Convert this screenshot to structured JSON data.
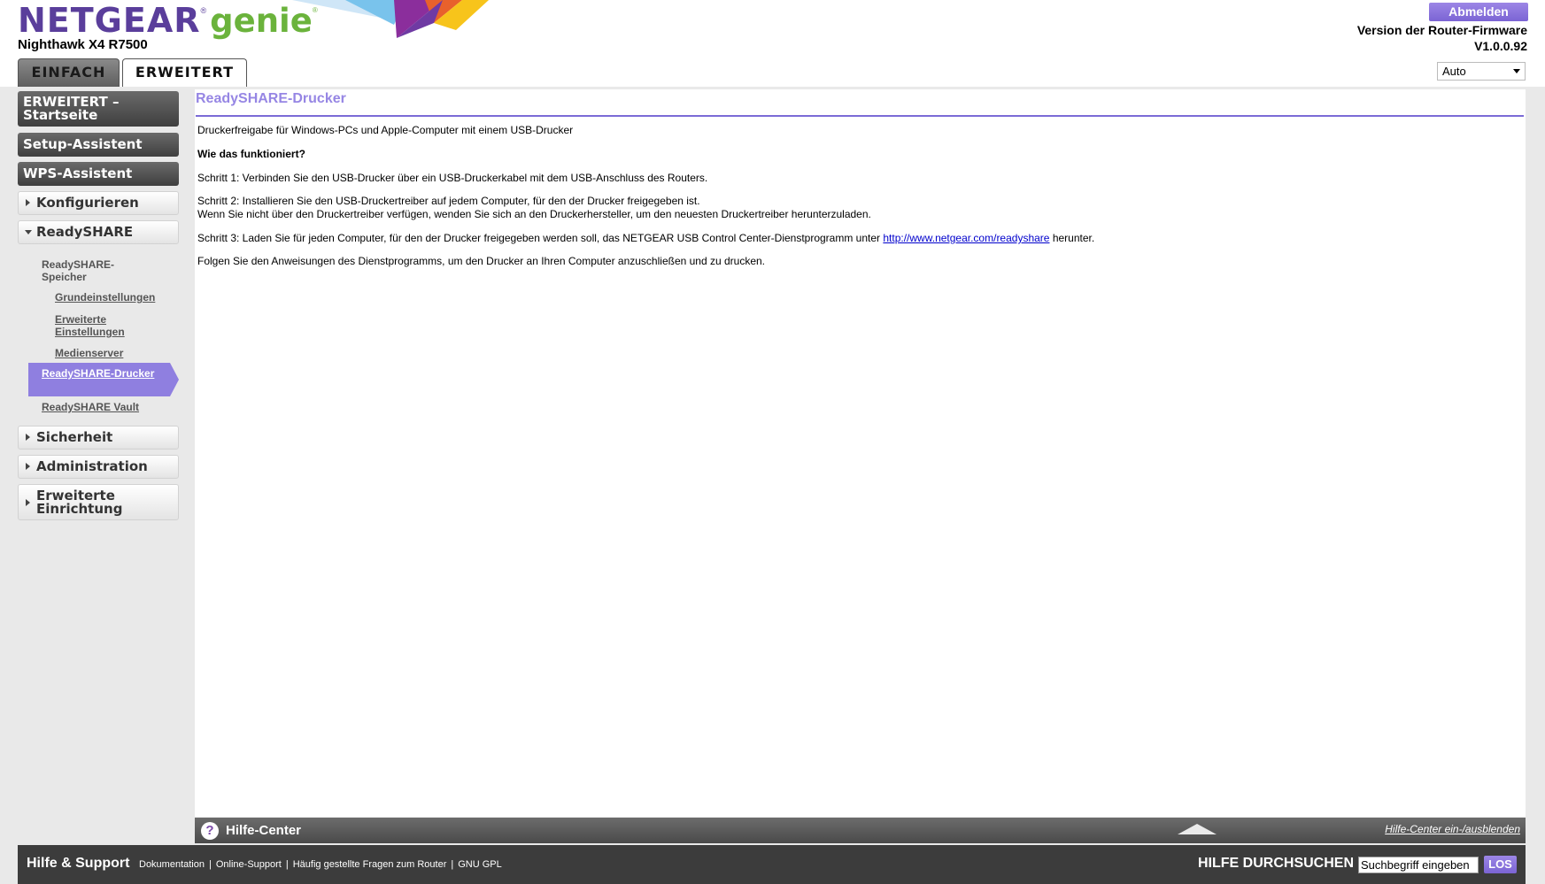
{
  "header": {
    "brand": "NETGEAR",
    "brand_reg": "®",
    "product": "genie",
    "product_reg": "®",
    "model": "Nighthawk X4 R7500",
    "tabs": [
      {
        "label": "EINFACH",
        "active": false
      },
      {
        "label": "ERWEITERT",
        "active": true
      }
    ],
    "logout_label": "Abmelden",
    "firmware_label": "Version der Router-Firmware",
    "firmware_version": "V1.0.0.92",
    "language": "Auto"
  },
  "sidebar": {
    "home_line1": "ERWEITERT –",
    "home_line2": "Startseite",
    "setup_wizard": "Setup-Assistent",
    "wps_wizard": "WPS-Assistent",
    "configure": "Konfigurieren",
    "readyshare": "ReadySHARE",
    "sub_heading_line1": "ReadySHARE-",
    "sub_heading_line2": "Speicher",
    "sub_basic": "Grundeinstellungen",
    "sub_advanced_line1": "Erweiterte",
    "sub_advanced_line2": "Einstellungen",
    "sub_media": "Medienserver",
    "sub_printer": "ReadySHARE-Drucker",
    "sub_vault": "ReadySHARE Vault",
    "security": "Sicherheit",
    "administration": "Administration",
    "advanced_setup_line1": "Erweiterte",
    "advanced_setup_line2": "Einrichtung",
    "active_color": "#8f7fe0"
  },
  "content": {
    "title": "ReadySHARE-Drucker",
    "intro": "Druckerfreigabe für Windows-PCs und Apple-Computer mit einem USB-Drucker",
    "how_heading": "Wie das funktioniert?",
    "step1": "Schritt 1: Verbinden Sie den USB-Drucker über ein USB-Druckerkabel mit dem USB-Anschluss des Routers.",
    "step2": "Schritt 2: Installieren Sie den USB-Druckertreiber auf jedem Computer, für den der Drucker freigegeben ist.",
    "step2_note": "Wenn Sie nicht über den Druckertreiber verfügen, wenden Sie sich an den Druckerhersteller, um den neuesten Druckertreiber herunterzuladen.",
    "step3_before": "Schritt 3: Laden Sie für jeden Computer, für den der Drucker freigegeben werden soll, das NETGEAR USB Control Center-Dienstprogramm unter ",
    "step3_link": "http://www.netgear.com/readyshare",
    "step3_after": " herunter.",
    "final": "Folgen Sie den Anweisungen des Dienstprogramms, um den Drucker an Ihren Computer anzuschließen und zu drucken."
  },
  "help_center": {
    "icon": "?",
    "title": "Hilfe-Center",
    "toggle": "Hilfe-Center ein-/ausblenden"
  },
  "footer": {
    "title": "Hilfe & Support",
    "links": [
      "Dokumentation",
      "Online-Support",
      "Häufig gestellte Fragen zum Router",
      "GNU GPL"
    ],
    "separator": "|",
    "search_label": "HILFE DURCHSUCHEN",
    "search_value": "Suchbegriff eingeben",
    "search_button": "LOS"
  }
}
